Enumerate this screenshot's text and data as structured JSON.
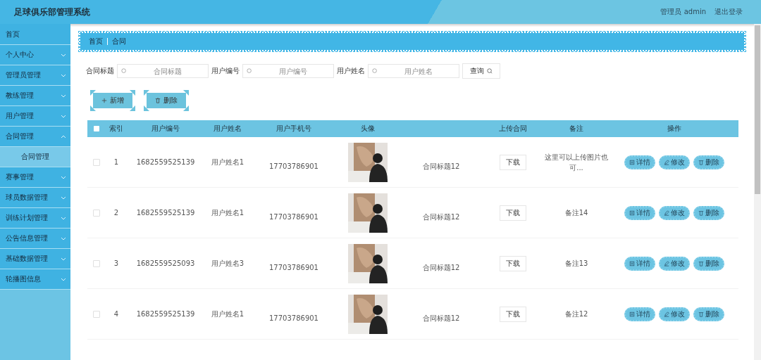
{
  "header": {
    "title": "足球俱乐部管理系统",
    "user": "管理员 admin",
    "logout": "退出登录"
  },
  "sidebar": {
    "items": [
      {
        "label": "首页",
        "expandable": false
      },
      {
        "label": "个人中心",
        "expandable": true,
        "expanded": false
      },
      {
        "label": "管理员管理",
        "expandable": true,
        "expanded": false
      },
      {
        "label": "教练管理",
        "expandable": true,
        "expanded": false
      },
      {
        "label": "用户管理",
        "expandable": true,
        "expanded": false
      },
      {
        "label": "合同管理",
        "expandable": true,
        "expanded": true,
        "children": [
          {
            "label": "合同管理",
            "selected": true
          }
        ]
      },
      {
        "label": "赛事管理",
        "expandable": true,
        "expanded": false
      },
      {
        "label": "球员数据管理",
        "expandable": true,
        "expanded": false
      },
      {
        "label": "训练计划管理",
        "expandable": true,
        "expanded": false
      },
      {
        "label": "公告信息管理",
        "expandable": true,
        "expanded": false
      },
      {
        "label": "基础数据管理",
        "expandable": true,
        "expanded": false
      },
      {
        "label": "轮播图信息",
        "expandable": true,
        "expanded": false
      }
    ]
  },
  "breadcrumb": [
    "首页",
    "合同"
  ],
  "search": {
    "fields": [
      {
        "label": "合同标题",
        "placeholder": "合同标题"
      },
      {
        "label": "用户编号",
        "placeholder": "用户编号"
      },
      {
        "label": "用户姓名",
        "placeholder": "用户姓名"
      }
    ],
    "button": "查询"
  },
  "toolbar": [
    {
      "kind": "add",
      "label": "新增"
    },
    {
      "kind": "delete",
      "label": "删除"
    }
  ],
  "table": {
    "select_all": {
      "checked": false
    },
    "columns": [
      "索引",
      "用户编号",
      "用户姓名",
      "用户手机号",
      "头像",
      "上传合同",
      "备注",
      "操作"
    ],
    "rows": [
      {
        "checked": false,
        "index": "1",
        "user_id": "1682559525139",
        "name": "用户姓名1",
        "phone": "17703786901",
        "avatar": {
          "kind": "picture"
        },
        "title": "合同标题12",
        "download": "下载",
        "note": "这里可以上传图片也可...",
        "actions": [
          "详情",
          "修改",
          "删除"
        ]
      },
      {
        "checked": false,
        "index": "2",
        "user_id": "1682559525139",
        "name": "用户姓名1",
        "phone": "17703786901",
        "avatar": {
          "kind": "picture"
        },
        "title": "合同标题12",
        "download": "下载",
        "note": "备注14",
        "actions": [
          "详情",
          "修改",
          "删除"
        ]
      },
      {
        "checked": false,
        "index": "3",
        "user_id": "1682559525093",
        "name": "用户姓名3",
        "phone": "17703786901",
        "avatar": {
          "kind": "picture"
        },
        "title": "合同标题12",
        "download": "下载",
        "note": "备注13",
        "actions": [
          "详情",
          "修改",
          "删除"
        ]
      },
      {
        "checked": false,
        "index": "4",
        "user_id": "1682559525139",
        "name": "用户姓名1",
        "phone": "17703786901",
        "avatar": {
          "kind": "picture"
        },
        "title": "合同标题12",
        "download": "下载",
        "note": "备注12",
        "actions": [
          "详情",
          "修改",
          "删除"
        ]
      }
    ]
  }
}
